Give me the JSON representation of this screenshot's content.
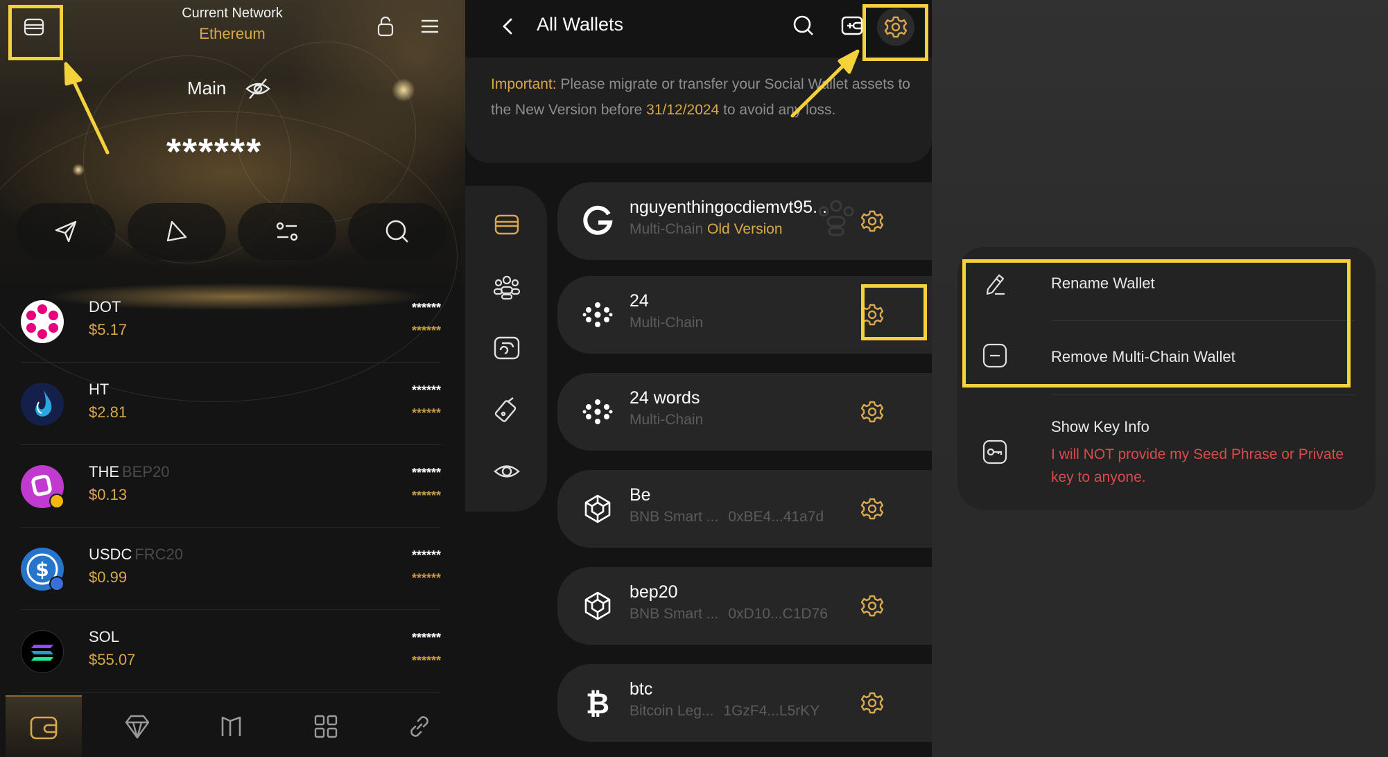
{
  "left": {
    "network_title": "Current Network",
    "network_name": "Ethereum",
    "wallet_label": "Main",
    "balance_mask": "******",
    "actions": [
      {
        "name": "send",
        "icon": "send-icon"
      },
      {
        "name": "receive",
        "icon": "receive-icon"
      },
      {
        "name": "swap",
        "icon": "swap-icon"
      },
      {
        "name": "search",
        "icon": "search-icon"
      }
    ],
    "assets": [
      {
        "symbol": "DOT",
        "chain": "",
        "price": "$5.17",
        "mask": "******",
        "color": "#e6007a"
      },
      {
        "symbol": "HT",
        "chain": "",
        "price": "$2.81",
        "mask": "******",
        "color": "#1a2a6a"
      },
      {
        "symbol": "THE",
        "chain": "BEP20",
        "price": "$0.13",
        "mask": "******",
        "color": "#c13ad0"
      },
      {
        "symbol": "USDC",
        "chain": "FRC20",
        "price": "$0.99",
        "mask": "******",
        "color": "#2775ca"
      },
      {
        "symbol": "SOL",
        "chain": "",
        "price": "$55.07",
        "mask": "******",
        "color": "#000000"
      }
    ],
    "bottom_nav": [
      "wallet-icon",
      "diamond-icon",
      "market-icon",
      "apps-icon",
      "link-icon"
    ]
  },
  "mid": {
    "title": "All Wallets",
    "notice": {
      "important": "Important:",
      "text1": " Please migrate or transfer your Social Wallet assets to the New Version before ",
      "date": "31/12/2024",
      "text2": " to avoid any loss."
    },
    "wallets": [
      {
        "name": "nguyenthingocdiemvt95...",
        "sub": "Multi-Chain",
        "tag": "Old Version",
        "addr": "",
        "icon": "google-icon"
      },
      {
        "name": "24",
        "sub": "Multi-Chain",
        "tag": "",
        "addr": "",
        "icon": "multichain-icon"
      },
      {
        "name": "24 words",
        "sub": "Multi-Chain",
        "tag": "",
        "addr": "",
        "icon": "multichain-icon"
      },
      {
        "name": "Be",
        "sub": "BNB Smart ...",
        "tag": "",
        "addr": "0xBE4...41a7d",
        "icon": "bnb-icon"
      },
      {
        "name": "bep20",
        "sub": "BNB Smart ...",
        "tag": "",
        "addr": "0xD10...C1D76",
        "icon": "bnb-icon"
      },
      {
        "name": "btc",
        "sub": "Bitcoin Leg...",
        "tag": "",
        "addr": "1GzF4...L5rKY",
        "icon": "bitcoin-icon"
      }
    ]
  },
  "right": {
    "menu": {
      "rename": "Rename Wallet",
      "remove": "Remove Multi-Chain Wallet",
      "show_key": "Show Key Info",
      "warning": "I will NOT provide my Seed Phrase or Private key to anyone."
    }
  },
  "colors": {
    "accent": "#d9a84b",
    "highlight": "#f5d13a",
    "danger": "#d94a4a"
  }
}
